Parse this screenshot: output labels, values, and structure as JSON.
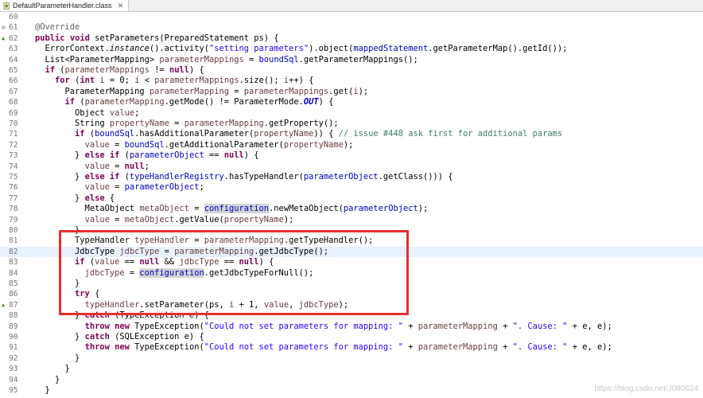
{
  "tab": {
    "title": "DefaultParameterHandler.class",
    "close_glyph": "✕"
  },
  "colors": {
    "keyword": "#7f0055",
    "string": "#2a00ff",
    "field": "#0000c0",
    "comment": "#3f7f5f",
    "highlight_box": "#e0322f"
  },
  "watermark": "https://blog.csdn.net/J080624",
  "lines": [
    {
      "n": "60",
      "marker": "",
      "text": ""
    },
    {
      "n": "61",
      "marker": "⊖",
      "text": ""
    },
    {
      "n": "62",
      "marker": "▲",
      "text": ""
    },
    {
      "n": "63",
      "marker": "",
      "text": ""
    },
    {
      "n": "64",
      "marker": "",
      "text": ""
    },
    {
      "n": "65",
      "marker": "",
      "text": ""
    },
    {
      "n": "66",
      "marker": "",
      "text": ""
    },
    {
      "n": "67",
      "marker": "",
      "text": ""
    },
    {
      "n": "68",
      "marker": "",
      "text": ""
    },
    {
      "n": "69",
      "marker": "",
      "text": ""
    },
    {
      "n": "70",
      "marker": "",
      "text": ""
    },
    {
      "n": "71",
      "marker": "",
      "text": ""
    },
    {
      "n": "72",
      "marker": "",
      "text": ""
    },
    {
      "n": "73",
      "marker": "",
      "text": ""
    },
    {
      "n": "74",
      "marker": "",
      "text": ""
    },
    {
      "n": "75",
      "marker": "",
      "text": ""
    },
    {
      "n": "76",
      "marker": "",
      "text": ""
    },
    {
      "n": "77",
      "marker": "",
      "text": ""
    },
    {
      "n": "78",
      "marker": "",
      "text": ""
    },
    {
      "n": "79",
      "marker": "",
      "text": ""
    },
    {
      "n": "80",
      "marker": "",
      "text": ""
    },
    {
      "n": "81",
      "marker": "",
      "text": ""
    },
    {
      "n": "82",
      "marker": "",
      "text": ""
    },
    {
      "n": "83",
      "marker": "",
      "text": ""
    },
    {
      "n": "84",
      "marker": "",
      "text": ""
    },
    {
      "n": "85",
      "marker": "",
      "text": ""
    },
    {
      "n": "86",
      "marker": "",
      "text": ""
    },
    {
      "n": "87",
      "marker": "",
      "text": ""
    },
    {
      "n": "88",
      "marker": "",
      "text": ""
    },
    {
      "n": "89",
      "marker": "",
      "text": ""
    },
    {
      "n": "90",
      "marker": "",
      "text": ""
    },
    {
      "n": "91",
      "marker": "",
      "text": ""
    },
    {
      "n": "92",
      "marker": "",
      "text": ""
    },
    {
      "n": "93",
      "marker": "",
      "text": ""
    },
    {
      "n": "94",
      "marker": "",
      "text": ""
    },
    {
      "n": "95",
      "marker": "",
      "text": ""
    }
  ],
  "code_text": [
    "",
    "@Override",
    "public void setParameters(PreparedStatement ps) {",
    "  ErrorContext.instance().activity(\"setting parameters\").object(mappedStatement.getParameterMap().getId());",
    "  List<ParameterMapping> parameterMappings = boundSql.getParameterMappings();",
    "  if (parameterMappings != null) {",
    "    for (int i = 0; i < parameterMappings.size(); i++) {",
    "      ParameterMapping parameterMapping = parameterMappings.get(i);",
    "      if (parameterMapping.getMode() != ParameterMode.OUT) {",
    "        Object value;",
    "        String propertyName = parameterMapping.getProperty();",
    "        if (boundSql.hasAdditionalParameter(propertyName)) { // issue #448 ask first for additional params",
    "          value = boundSql.getAdditionalParameter(propertyName);",
    "        } else if (parameterObject == null) {",
    "          value = null;",
    "        } else if (typeHandlerRegistry.hasTypeHandler(parameterObject.getClass())) {",
    "          value = parameterObject;",
    "        } else {",
    "          MetaObject metaObject = configuration.newMetaObject(parameterObject);",
    "          value = metaObject.getValue(propertyName);",
    "        }",
    "        TypeHandler typeHandler = parameterMapping.getTypeHandler();",
    "        JdbcType jdbcType = parameterMapping.getJdbcType();",
    "        if (value == null && jdbcType == null) {",
    "          jdbcType = configuration.getJdbcTypeForNull();",
    "        }",
    "        try {",
    "          typeHandler.setParameter(ps, i + 1, value, jdbcType);",
    "        } catch (TypeException e) {",
    "          throw new TypeException(\"Could not set parameters for mapping: \" + parameterMapping + \". Cause: \" + e, e);",
    "        } catch (SQLException e) {",
    "          throw new TypeException(\"Could not set parameters for mapping: \" + parameterMapping + \". Cause: \" + e, e);",
    "        }",
    "      }",
    "    }",
    "  }"
  ]
}
